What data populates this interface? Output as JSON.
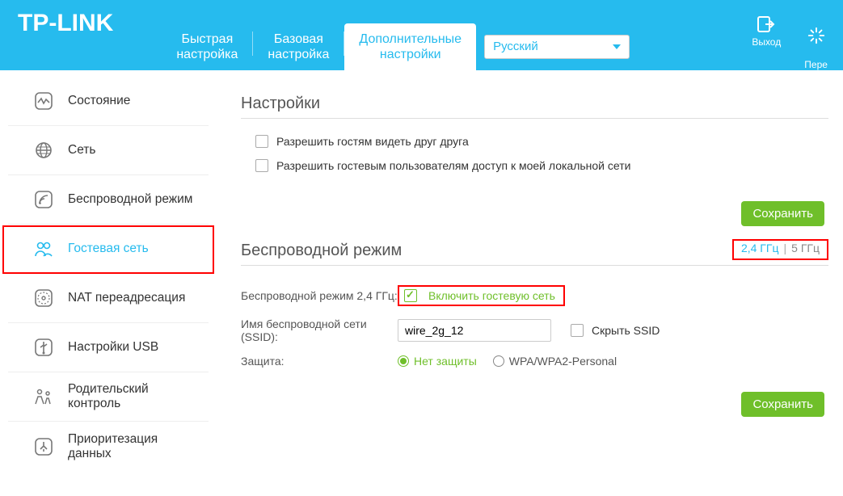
{
  "header": {
    "logo": "TP-LINK",
    "tabs": {
      "quick": "Быстрая\nнастройка",
      "basic": "Базовая\nнастройка",
      "advanced": "Дополнительные\nнастройки"
    },
    "language": "Русский",
    "logout": "Выход",
    "reboot": "Пере\nзагрузка"
  },
  "sidebar": {
    "items": [
      {
        "label": "Состояние"
      },
      {
        "label": "Сеть"
      },
      {
        "label": "Беспроводной режим"
      },
      {
        "label": "Гостевая сеть"
      },
      {
        "label": "NAT переадресация"
      },
      {
        "label": "Настройки USB"
      },
      {
        "label": "Родительский контроль"
      },
      {
        "label": "Приоритезация данных"
      }
    ]
  },
  "content": {
    "section1_title": "Настройки",
    "chk1_label": "Разрешить гостям видеть друг друга",
    "chk2_label": "Разрешить гостевым пользователям доступ к моей локальной сети",
    "save_btn": "Сохранить",
    "section2_title": "Беспроводной режим",
    "band24": "2,4 ГГц",
    "band5": "5 ГГц",
    "row1_label": "Беспроводной режим 2,4 ГГц:",
    "enable_label": "Включить гостевую сеть",
    "row2_label": "Имя беспроводной сети (SSID):",
    "ssid_value": "wire_2g_12",
    "hide_ssid": "Скрыть SSID",
    "row3_label": "Защита:",
    "sec_none": "Нет защиты",
    "sec_wpa": "WPA/WPA2-Personal"
  }
}
